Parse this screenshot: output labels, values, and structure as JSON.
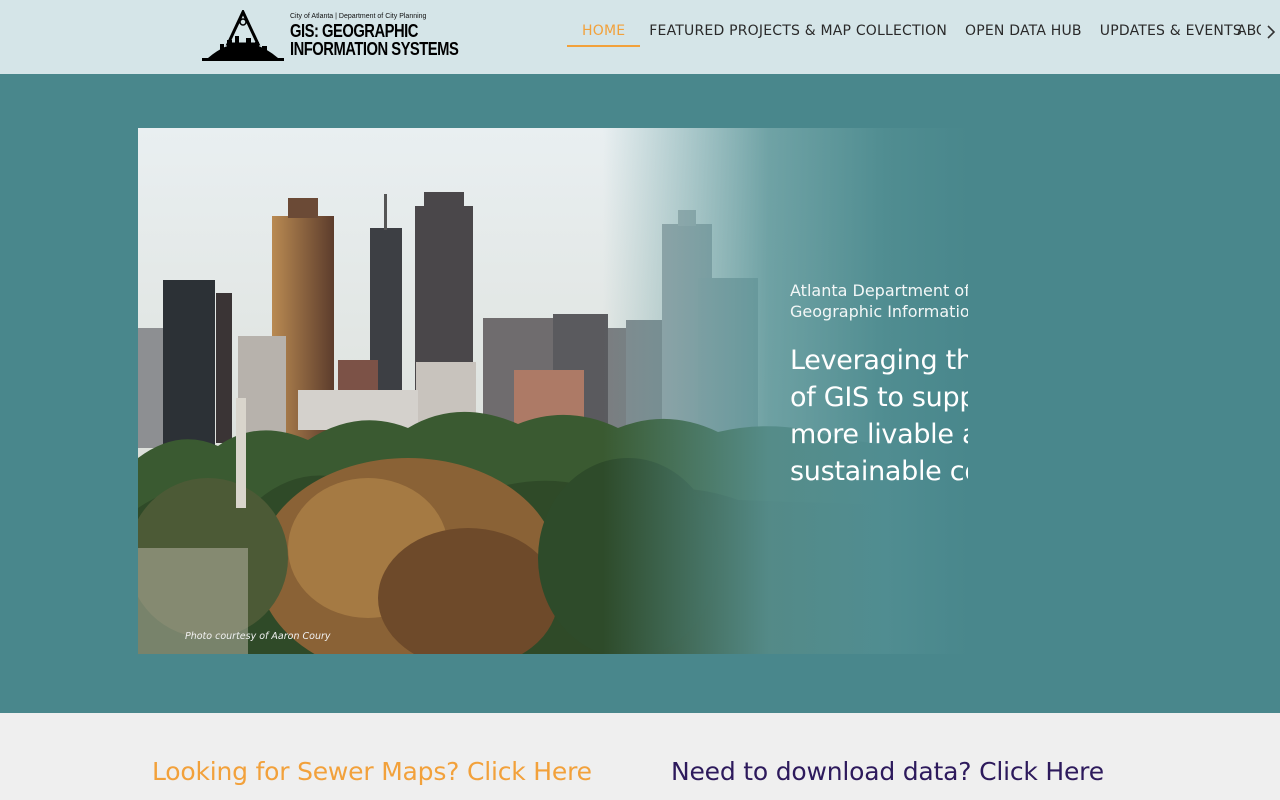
{
  "header": {
    "logo": {
      "small_text": "City of Atlanta | Department of City Planning",
      "line1": "GIS: GEOGRAPHIC",
      "line2": "INFORMATION SYSTEMS"
    },
    "nav": {
      "items": [
        {
          "label": "HOME",
          "active": true
        },
        {
          "label": "FEATURED PROJECTS & MAP COLLECTION",
          "active": false
        },
        {
          "label": "OPEN DATA HUB",
          "active": false
        },
        {
          "label": "UPDATES & EVENTS",
          "active": false
        },
        {
          "label": "ABOUT",
          "active": false
        }
      ],
      "scroll_icon": "chevron-right-icon"
    }
  },
  "hero": {
    "subtitle_line1": "Atlanta Department of City Planning:",
    "subtitle_line2": "Geographic Information Systems (GIS)",
    "headline_line1": "Leveraging the power",
    "headline_line2": "of GIS to support a",
    "headline_line3": "more livable and",
    "headline_line4": "sustainable community.",
    "photo_credit": "Photo courtesy of Aaron Coury"
  },
  "links": {
    "sewer": "Looking for Sewer Maps? Click Here",
    "data": "Need to download data? Click Here"
  },
  "colors": {
    "header_bg": "#d5e5e8",
    "hero_bg": "#49878c",
    "accent_orange": "#f2a13b",
    "link_purple": "#2d1a5c"
  }
}
